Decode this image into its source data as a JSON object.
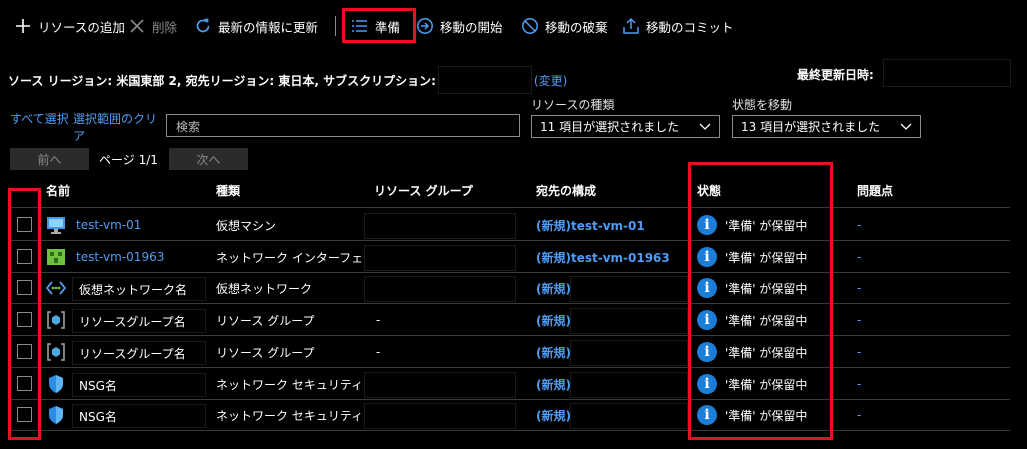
{
  "toolbar": {
    "add_label": "リソースの追加",
    "delete_label": "削除",
    "refresh_label": "最新の情報に更新",
    "prepare_label": "準備",
    "initiate_label": "移動の開始",
    "discard_label": "移動の破棄",
    "commit_label": "移動のコミット"
  },
  "info": {
    "source_region_label": "ソース リージョン:",
    "source_region": "米国東部 2,",
    "target_region_label": "宛先リージョン:",
    "target_region": "東日本,",
    "subscription_label": "サブスクリプション:",
    "change_label": "(変更)",
    "last_updated_label": "最終更新日時:"
  },
  "filters": {
    "select_all": "すべて選択",
    "clear_selection": "選択範囲のクリア",
    "search_placeholder": "検索",
    "resource_type_label": "リソースの種類",
    "resource_type_value": "11 項目が選択されました",
    "move_state_label": "状態を移動",
    "move_state_value": "13 項目が選択されました"
  },
  "pager": {
    "prev": "前へ",
    "page": "ページ 1/1",
    "next": "次へ"
  },
  "table": {
    "headers": {
      "name": "名前",
      "type": "種類",
      "resource_group": "リソース グループ",
      "destination": "宛先の構成",
      "state": "状態",
      "issues": "問題点"
    },
    "rows": [
      {
        "name": "test-vm-01",
        "icon": "vm-icon",
        "type": "仮想マシン",
        "resource_group": "",
        "destination": "(新規)test-vm-01",
        "state": "'準備' が保留中",
        "issues": "-"
      },
      {
        "name": "test-vm-01963",
        "icon": "nic-icon",
        "type": "ネットワーク インターフェイス",
        "resource_group": "",
        "destination": "(新規)test-vm-01963",
        "state": "'準備' が保留中",
        "issues": "-"
      },
      {
        "name": "仮想ネットワーク名",
        "icon": "vnet-icon",
        "type": "仮想ネットワーク",
        "resource_group": "",
        "destination": "(新規)",
        "state": "'準備' が保留中",
        "issues": "-"
      },
      {
        "name": "リソースグループ名",
        "icon": "resource-group-icon",
        "type": "リソース グループ",
        "resource_group": "-",
        "destination": "(新規)",
        "state": "'準備' が保留中",
        "issues": "-"
      },
      {
        "name": "リソースグループ名",
        "icon": "resource-group-icon",
        "type": "リソース グループ",
        "resource_group": "-",
        "destination": "(新規)",
        "state": "'準備' が保留中",
        "issues": "-"
      },
      {
        "name": "NSG名",
        "icon": "nsg-icon",
        "type": "ネットワーク セキュリティ グル...",
        "resource_group": "",
        "destination": "(新規)",
        "state": "'準備' が保留中",
        "issues": "-"
      },
      {
        "name": "NSG名",
        "icon": "nsg-icon",
        "type": "ネットワーク セキュリティ グル...",
        "resource_group": "",
        "destination": "(新規)",
        "state": "'準備' が保留中",
        "issues": "-"
      }
    ]
  },
  "colors": {
    "accent": "#4f9cf5",
    "highlight": "#e81123",
    "info": "#1c7ed6"
  }
}
